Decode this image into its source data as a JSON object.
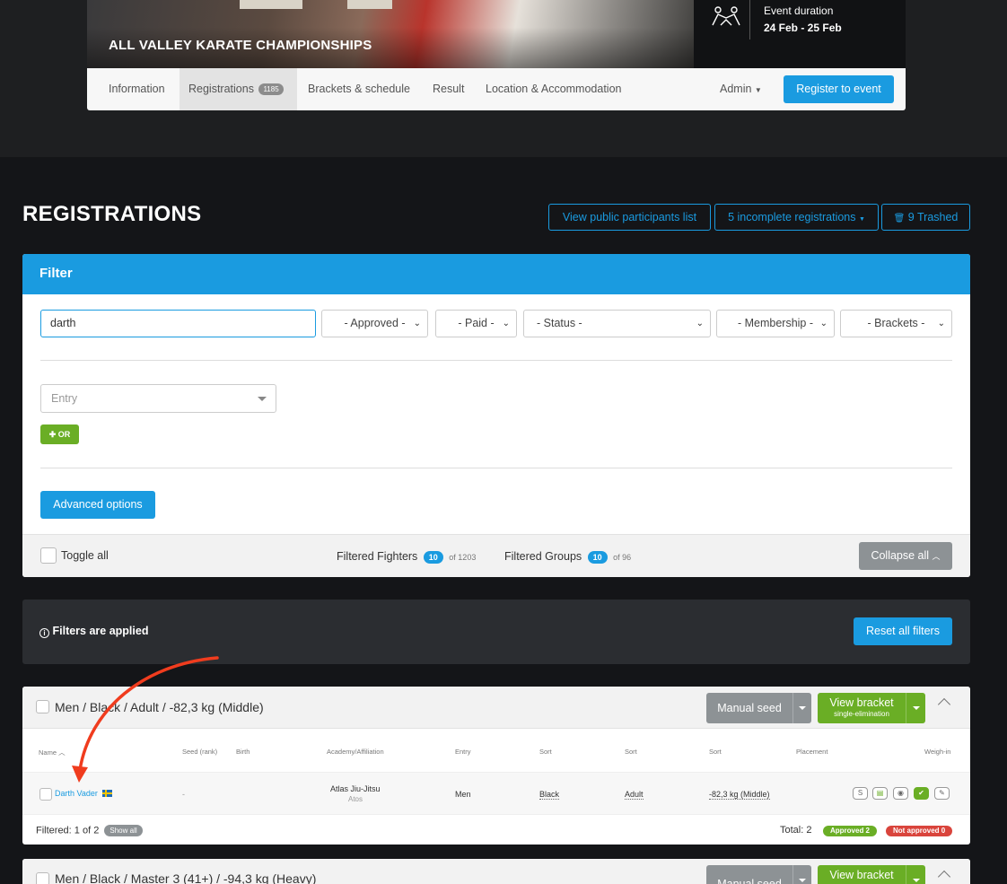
{
  "event": {
    "title": "ALL VALLEY KARATE CHAMPIONSHIPS",
    "duration_label": "Event duration",
    "duration_value": "24 Feb - 25 Feb",
    "icon": "wrestlers-icon"
  },
  "nav": {
    "information": "Information",
    "registrations": "Registrations",
    "registrations_count": "1185",
    "brackets": "Brackets & schedule",
    "result": "Result",
    "location": "Location & Accommodation",
    "admin": "Admin",
    "register": "Register to event"
  },
  "page": {
    "title": "REGISTRATIONS",
    "public_list": "View public participants list",
    "incomplete": "5 incomplete registrations",
    "trashed": "9 Trashed"
  },
  "filter": {
    "heading": "Filter",
    "search_value": "darth",
    "approved": "- Approved -",
    "paid": "- Paid -",
    "status": "- Status -",
    "membership": "- Membership -",
    "brackets": "- Brackets -",
    "entry_placeholder": "Entry",
    "or_button": "OR",
    "advanced": "Advanced options",
    "toggle_all": "Toggle all",
    "filtered_fighters": "Filtered Fighters",
    "fighters_count": "10",
    "fighters_total": "of 1203",
    "filtered_groups": "Filtered Groups",
    "groups_count": "10",
    "groups_total": "of 96",
    "collapse_all": "Collapse all"
  },
  "applied": {
    "text": "Filters are applied",
    "reset": "Reset all filters"
  },
  "groups": [
    {
      "title": "Men / Black / Adult / -82,3 kg (Middle)",
      "manual_seed": "Manual seed",
      "view_bracket": "View bracket",
      "bracket_type": "single-elimination",
      "columns": {
        "name": "Name",
        "seed": "Seed (rank)",
        "birth": "Birth",
        "academy": "Academy/Affiliation",
        "entry": "Entry",
        "sort1": "Sort",
        "sort2": "Sort",
        "sort3": "Sort",
        "placement": "Placement",
        "weigh_in": "Weigh-in"
      },
      "row": {
        "name": "Darth Vader",
        "seed": "-",
        "academy": "Atlas Jiu-Jitsu",
        "affiliation": "Atos",
        "entry": "Men",
        "belt": "Black",
        "age": "Adult",
        "weight": "-82,3 kg (Middle)",
        "weigh_s": "S"
      },
      "filtered": "Filtered: 1 of 2",
      "show_all": "Show all",
      "total": "Total: 2",
      "approved": "Approved 2",
      "not_approved": "Not approved 0"
    },
    {
      "title": "Men / Black / Master 3 (41+) / -94,3 kg (Heavy)",
      "manual_seed": "Manual seed",
      "view_bracket": "View bracket"
    }
  ],
  "colors": {
    "primary": "#1a9be0",
    "success": "#6aae25",
    "danger": "#d9443c",
    "annotation": "#f03c1e"
  }
}
